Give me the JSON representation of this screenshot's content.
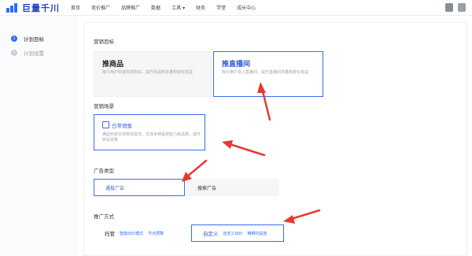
{
  "header": {
    "logo_text": "巨量千川",
    "nav": [
      "首页",
      "竞价推广",
      "品牌推广",
      "数据",
      "工具",
      "财务",
      "学堂",
      "成长中心"
    ]
  },
  "sidebar": {
    "items": [
      {
        "num": "1",
        "label": "计划目标"
      },
      {
        "num": "2",
        "label": "计划设置"
      }
    ]
  },
  "main": {
    "goal_title": "营销目标",
    "goal_cards": [
      {
        "title": "推商品",
        "desc": "吸引用户快速完成购买，提升商品购买量和转化效益"
      },
      {
        "title": "推直播间",
        "desc": "吸引用户进入直播间，提升直播间流量和转化效益"
      }
    ],
    "scene_title": "营销场景",
    "scene_card": {
      "title": "日常销售",
      "desc": "满足商家日常带货需求，支持多种投放能力和选择，提升转化效果"
    },
    "adtype_title": "广告类型",
    "adtype_options": [
      "通投广告",
      "搜索广告"
    ],
    "method_title": "推广方式",
    "method_options": [
      {
        "label": "托管",
        "subs": [
          "智能出价模式",
          "节点预算"
        ]
      },
      {
        "label": "自定义",
        "subs": [
          "自定义出价",
          "精细化投放"
        ]
      }
    ]
  },
  "colors": {
    "accent": "#2f6bff",
    "arrow": "#e53935"
  }
}
